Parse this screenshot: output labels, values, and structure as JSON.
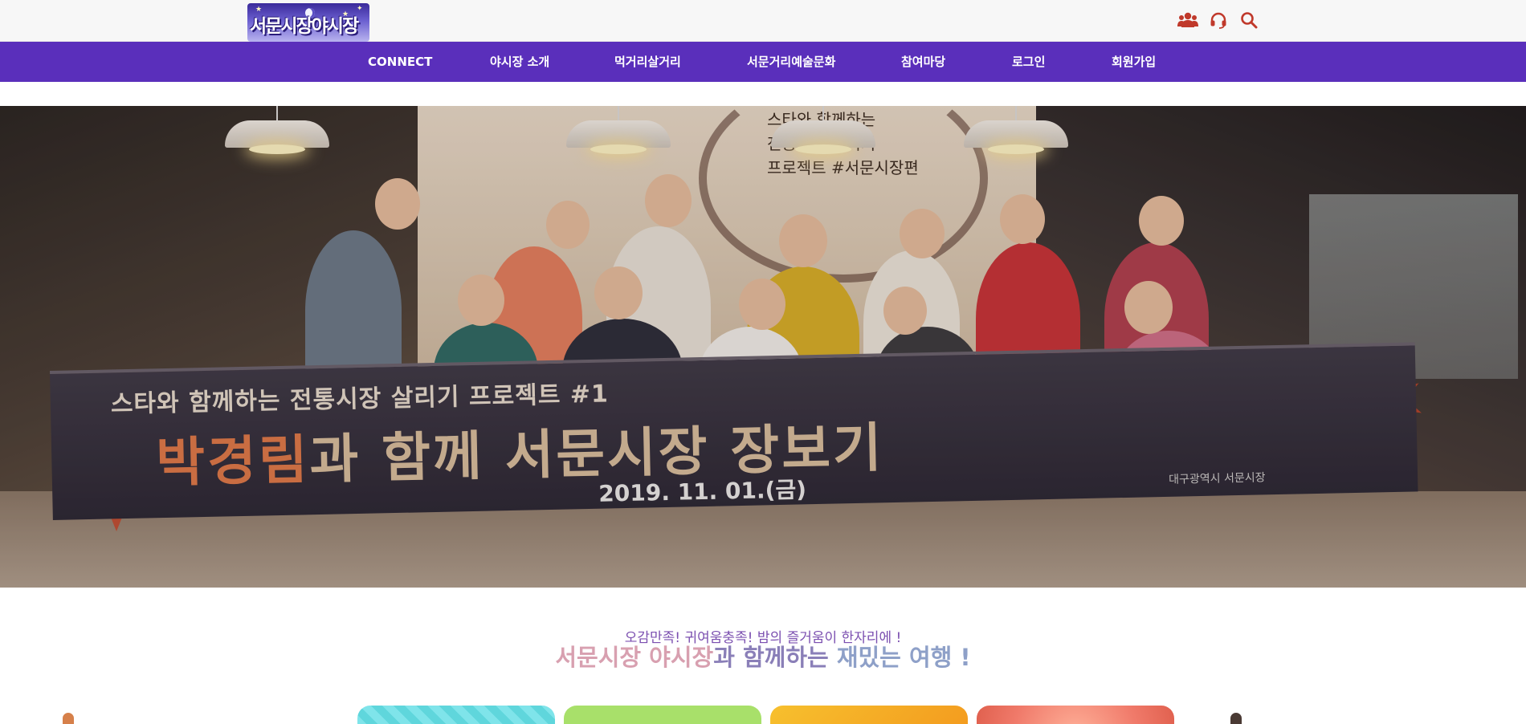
{
  "header": {
    "logo_text": "서문시장야시장",
    "icons": [
      "members-icon",
      "headset-icon",
      "search-icon"
    ],
    "colors": {
      "icon": "#c0392b",
      "nav_background": "#5a2fbb",
      "nav_text": "#ffffff"
    }
  },
  "nav": {
    "items": [
      {
        "label": "CONNECT"
      },
      {
        "label": "야시장 소개"
      },
      {
        "label": "먹거리살거리"
      },
      {
        "label": "서문거리예술문화"
      },
      {
        "label": "참여마당"
      },
      {
        "label": "로그인"
      },
      {
        "label": "회원가입"
      }
    ]
  },
  "hero": {
    "wall_text": [
      "스타와 함께하는",
      "전통시장 살리기",
      "프로젝트 #서문시장편"
    ],
    "banner_subtitle": "스타와 함께하는 전통시장 살리기 프로젝트 #1",
    "banner_title_accent": "박경림",
    "banner_title_rest": "과 함께 서문시장 장보기",
    "banner_date": "2019. 11. 01.(금)",
    "banner_org": "대구광역시  서문시장"
  },
  "intro": {
    "subtitle": "오감만족! 귀여움충족! 밤의 즐거움이 한자리에 !",
    "title_part1": "서문시장 야시장",
    "title_part2": "과 함께하는",
    "title_part3": " 재밌는 여행 !"
  },
  "cards": {
    "colors": [
      "#5fd6dc",
      "#a8e06a",
      "#f5b830",
      "#f07a6a"
    ]
  }
}
